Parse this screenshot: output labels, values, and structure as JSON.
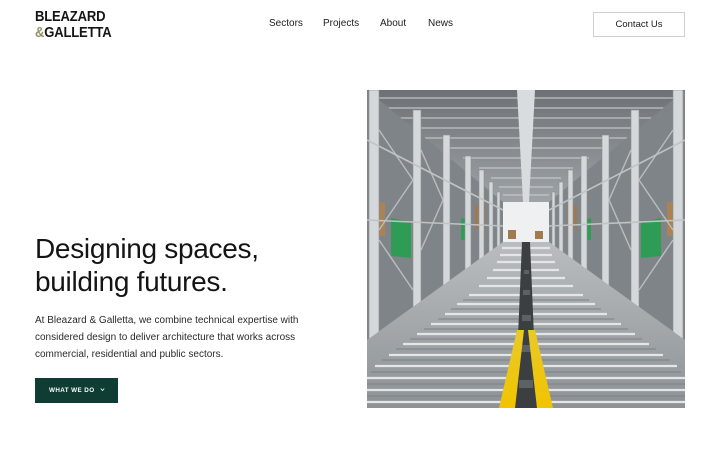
{
  "brand": {
    "line1": "BLEAZARD",
    "amp": "&",
    "line2": "GALLETTA",
    "accent_color": "#9a8f64"
  },
  "nav": {
    "items": [
      {
        "label": "Sectors"
      },
      {
        "label": "Projects"
      },
      {
        "label": "About"
      },
      {
        "label": "News"
      }
    ],
    "contact_label": "Contact Us"
  },
  "hero": {
    "title_line1": "Designing spaces,",
    "title_line2": "building futures.",
    "body": "At Bleazard & Galletta, we combine technical expertise with considered design to deliver architecture that works across commercial, residential and public sectors.",
    "cta_label": "WHAT WE DO",
    "cta_icon": "chevron-down-icon",
    "cta_color": "#0f3d33",
    "image_subject": "warehouse-racking-aisle"
  }
}
